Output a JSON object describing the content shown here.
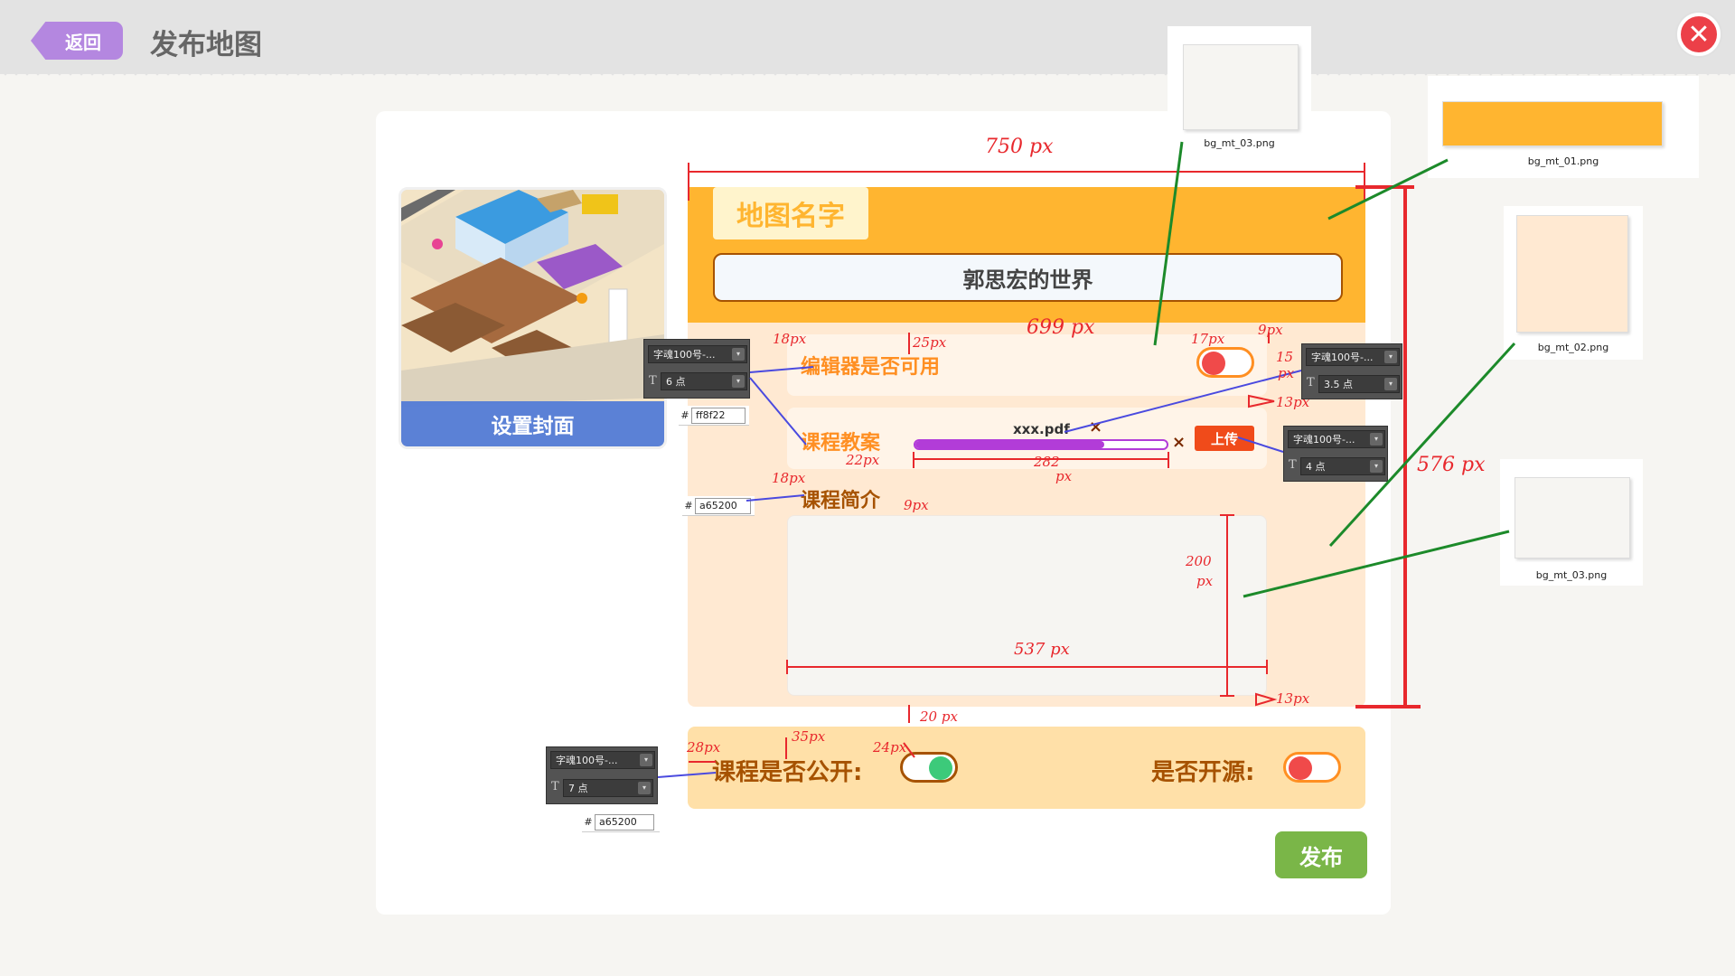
{
  "header": {
    "back_label": "返回",
    "title": "发布地图",
    "close_icon": "close-icon"
  },
  "cover": {
    "label": "设置封面"
  },
  "form": {
    "map_name_tab": "地图名字",
    "world_name": "郭思宏的世界",
    "editor_label": "编辑器是否可用",
    "course_plan_label": "课程教案",
    "file_name": "xxx.pdf",
    "remove_glyph": "×",
    "upload_progress": 0.75,
    "upload_label": "上传",
    "intro_label": "课程简介",
    "intro_value": "",
    "public_label": "课程是否公开:",
    "open_source_label": "是否开源:",
    "publish_label": "发布"
  },
  "toggles": {
    "editor_enabled": false,
    "course_public": true,
    "open_source": false
  },
  "assets": [
    {
      "name": "bg_mt_03.png",
      "color": "#f6f5f2"
    },
    {
      "name": "bg_mt_01.png",
      "color": "#ffb530"
    },
    {
      "name": "bg_mt_02.png",
      "color": "#ffe9d2"
    },
    {
      "name": "bg_mt_03.png",
      "color": "#f6f5f2"
    }
  ],
  "ps_panels": [
    {
      "font": "字魂100号-...",
      "size": "6 点",
      "hex": "ff8f22"
    },
    {
      "font": "字魂100号-...",
      "size": "3.5 点"
    },
    {
      "font": "字魂100号-...",
      "size": "4 点"
    },
    {
      "font": "字魂100号-...",
      "size": "7 点",
      "hex": "a65200"
    }
  ],
  "hex_intro": "a65200",
  "annotations": {
    "w750": "750 px",
    "w699": "699 px",
    "h576": "576 px",
    "a18_1": "18px",
    "a25": "25px",
    "a17": "17px",
    "a9_1": "9px",
    "a15": "15",
    "a15px": "px",
    "a13_1": "13px",
    "a22": "22px",
    "a282": "282",
    "a282px": "px",
    "a18_2": "18px",
    "a9_2": "9px",
    "a200": "200",
    "a200px": "px",
    "a537": "537 px",
    "a13_2": "13px",
    "a20": "20 px",
    "a35": "35px",
    "a28": "28px",
    "a24": "24px"
  },
  "colors": {
    "orange": "#ffb530",
    "accent": "#ff8f22",
    "brown": "#a65200",
    "green": "#7ab648",
    "annotation_red": "#e8282d"
  }
}
